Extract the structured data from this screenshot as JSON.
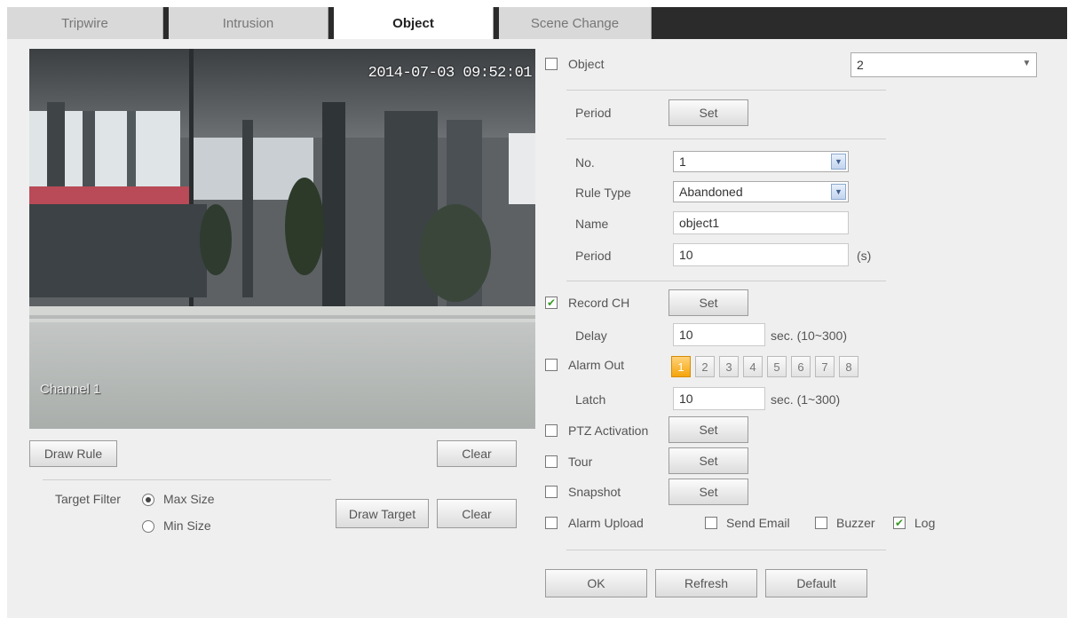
{
  "tabs": [
    {
      "label": "Tripwire",
      "active": false
    },
    {
      "label": "Intrusion",
      "active": false
    },
    {
      "label": "Object",
      "active": true
    },
    {
      "label": "Scene Change",
      "active": false
    }
  ],
  "video": {
    "timestamp": "2014-07-03 09:52:01",
    "channel_label": "Channel 1"
  },
  "left_buttons": {
    "draw_rule": "Draw Rule",
    "clear_rule": "Clear",
    "draw_target": "Draw Target",
    "clear_target": "Clear"
  },
  "target_filter": {
    "label": "Target Filter",
    "options": [
      {
        "label": "Max Size",
        "selected": true
      },
      {
        "label": "Min Size",
        "selected": false
      }
    ]
  },
  "object_enable": {
    "label": "Object",
    "checked": false
  },
  "object_select_value": "2",
  "period_top": {
    "label": "Period",
    "button": "Set"
  },
  "rule": {
    "no_label": "No.",
    "no_value": "1",
    "rule_type_label": "Rule Type",
    "rule_type_value": "Abandoned",
    "name_label": "Name",
    "name_value": "object1",
    "period_label": "Period",
    "period_value": "10",
    "period_unit": "(s)"
  },
  "record_ch": {
    "label": "Record CH",
    "checked": true,
    "button": "Set"
  },
  "delay": {
    "label": "Delay",
    "value": "10",
    "unit": "sec. (10~300)"
  },
  "alarm_out": {
    "label": "Alarm Out",
    "checked": false,
    "channels": [
      "1",
      "2",
      "3",
      "4",
      "5",
      "6",
      "7",
      "8"
    ],
    "selected": "1"
  },
  "latch": {
    "label": "Latch",
    "value": "10",
    "unit": "sec. (1~300)"
  },
  "ptz_activation": {
    "label": "PTZ Activation",
    "checked": false,
    "button": "Set"
  },
  "tour": {
    "label": "Tour",
    "checked": false,
    "button": "Set"
  },
  "snapshot": {
    "label": "Snapshot",
    "checked": false,
    "button": "Set"
  },
  "alarm_upload": {
    "label": "Alarm Upload",
    "checked": false
  },
  "send_email": {
    "label": "Send Email",
    "checked": false
  },
  "buzzer": {
    "label": "Buzzer",
    "checked": false
  },
  "log": {
    "label": "Log",
    "checked": true
  },
  "footer": {
    "ok": "OK",
    "refresh": "Refresh",
    "default": "Default"
  },
  "colors": {
    "tabbar_bg": "#2b2b2b",
    "panel_bg": "#efefef",
    "alarm_selected": "#f4a50b",
    "check_green": "#3a9a26"
  }
}
